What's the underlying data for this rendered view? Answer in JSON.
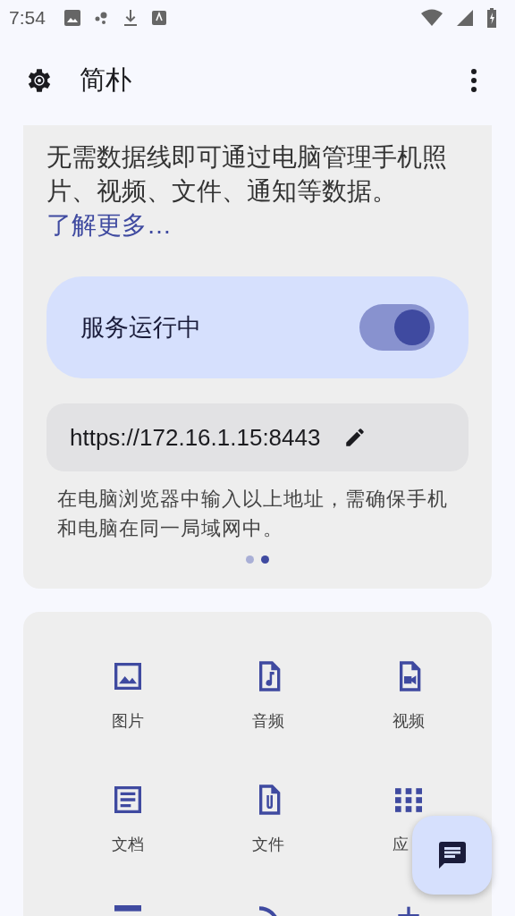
{
  "status_bar": {
    "time": "7:54"
  },
  "app_bar": {
    "title": "简朴"
  },
  "intro": {
    "text": "无需数据线即可通过电脑管理手机照片、视频、文件、通知等数据。",
    "link": "了解更多…"
  },
  "service": {
    "label": "服务运行中",
    "on": true
  },
  "address": {
    "url": "https://172.16.1.15:8443"
  },
  "hint": "在电脑浏览器中输入以上地址，需确保手机和电脑在同一局域网中。",
  "pages": [
    {
      "selected": false
    },
    {
      "selected": true
    }
  ],
  "features": [
    {
      "kind": "image",
      "label": "图片"
    },
    {
      "kind": "audio",
      "label": "音频"
    },
    {
      "kind": "video",
      "label": "视频"
    },
    {
      "kind": "doc",
      "label": "文档"
    },
    {
      "kind": "file",
      "label": "文件"
    },
    {
      "kind": "apps",
      "label": "应"
    },
    {
      "kind": "bar"
    },
    {
      "kind": "arc"
    },
    {
      "kind": "stem"
    }
  ]
}
